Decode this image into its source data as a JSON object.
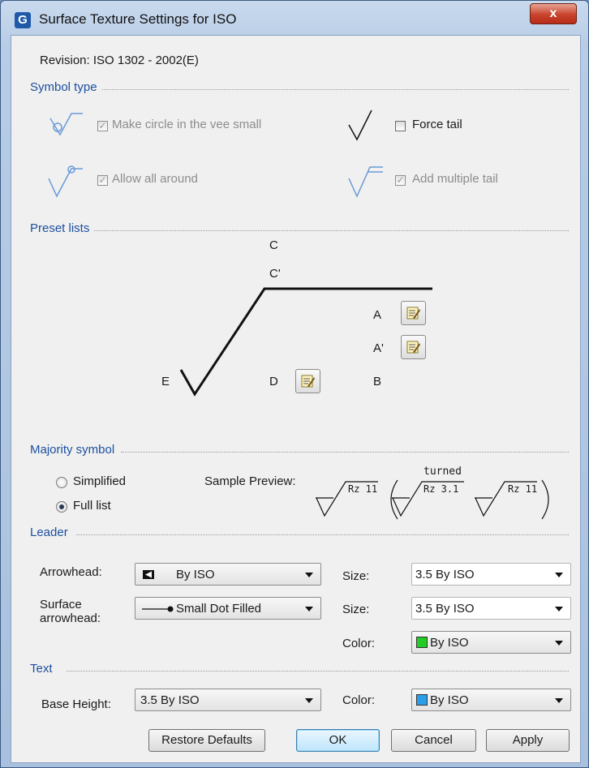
{
  "window": {
    "title": "Surface Texture Settings for ISO",
    "close_label": "x"
  },
  "revision": "Revision: ISO 1302 - 2002(E)",
  "symbol_type": {
    "title": "Symbol type",
    "make_circle": {
      "label": "Make circle in the vee small",
      "checked": true,
      "enabled": false
    },
    "force_tail": {
      "label": "Force tail",
      "checked": false,
      "enabled": true
    },
    "allow_all_around": {
      "label": "Allow all around",
      "checked": true,
      "enabled": false
    },
    "add_multiple_tail": {
      "label": "Add multiple tail",
      "checked": true,
      "enabled": false
    }
  },
  "preset_lists": {
    "title": "Preset lists",
    "labels": {
      "c": "C",
      "c_prime": "C'",
      "a": "A",
      "a_prime": "A'",
      "b": "B",
      "d": "D",
      "e": "E"
    }
  },
  "majority_symbol": {
    "title": "Majority symbol",
    "options": [
      {
        "label": "Simplified",
        "selected": false
      },
      {
        "label": "Full list",
        "selected": true
      }
    ],
    "sample_label": "Sample Preview:",
    "preview": {
      "first": "Rz 11",
      "turned": "turned",
      "middle": "Rz 3.1",
      "last": "Rz 11"
    }
  },
  "leader": {
    "title": "Leader",
    "arrowhead_label": "Arrowhead:",
    "arrowhead_value": "By ISO",
    "surface_arrowhead_label_1": "Surface",
    "surface_arrowhead_label_2": "arrowhead:",
    "surface_arrowhead_value": "Small Dot Filled",
    "size_label": "Size:",
    "size_value_1": "3.5 By ISO",
    "size_value_2": "3.5 By ISO",
    "color_label": "Color:",
    "color_value": "By ISO",
    "color_swatch": "#22cc22"
  },
  "text": {
    "title": "Text",
    "base_height_label": "Base Height:",
    "base_height_value": "3.5 By ISO",
    "color_label": "Color:",
    "color_value": "By ISO",
    "color_swatch": "#2a9ee8"
  },
  "buttons": {
    "restore": "Restore Defaults",
    "ok": "OK",
    "cancel": "Cancel",
    "apply": "Apply"
  },
  "colors": {
    "group_title": "#1c4fa0",
    "title_bar": "#c9daee"
  }
}
